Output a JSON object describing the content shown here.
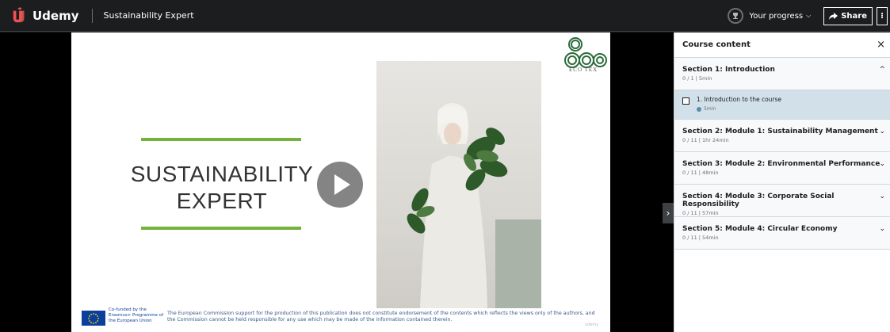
{
  "topbar": {
    "brand": "Udemy",
    "course_title": "Sustainability Expert",
    "progress_label": "Your progress",
    "share_label": "Share",
    "more_label": "⁝"
  },
  "slide": {
    "title_line1": "SUSTAINABILITY",
    "title_line2": "EXPERT",
    "logo_sub": "ECO TEX",
    "eu_text": "Co-funded by the Erasmus+ Programme of the European Union",
    "disclaimer": "The European Commission support for the production of this publication does not constitute endorsement of the contents which reflects the views only of the authors, and the Commission cannot be held responsible for any use which may be made of the information contained therein.",
    "watermark": "udemy"
  },
  "sidebar": {
    "title": "Course content",
    "close": "×",
    "sections": [
      {
        "title": "Section 1: Introduction",
        "meta": "0 / 1 | 5min",
        "chev": "^"
      },
      {
        "title": "Section 2: Module 1: Sustainability Management",
        "meta": "0 / 11 | 1hr 24min",
        "chev": "⌄"
      },
      {
        "title": "Section 3: Module 2: Environmental Performance",
        "meta": "0 / 11 | 48min",
        "chev": "⌄"
      },
      {
        "title": "Section 4: Module 3: Corporate Social Responsibility",
        "meta": "0 / 11 | 57min",
        "chev": "⌄"
      },
      {
        "title": "Section 5: Module 4: Circular Economy",
        "meta": "0 / 11 | 54min",
        "chev": "⌄"
      }
    ],
    "lecture": {
      "title": "1. Introduction to the course",
      "meta": "5min"
    }
  },
  "colors": {
    "accent_green": "#74b23b",
    "udemy_red": "#ec5252",
    "active_row": "#d1e0e9"
  }
}
